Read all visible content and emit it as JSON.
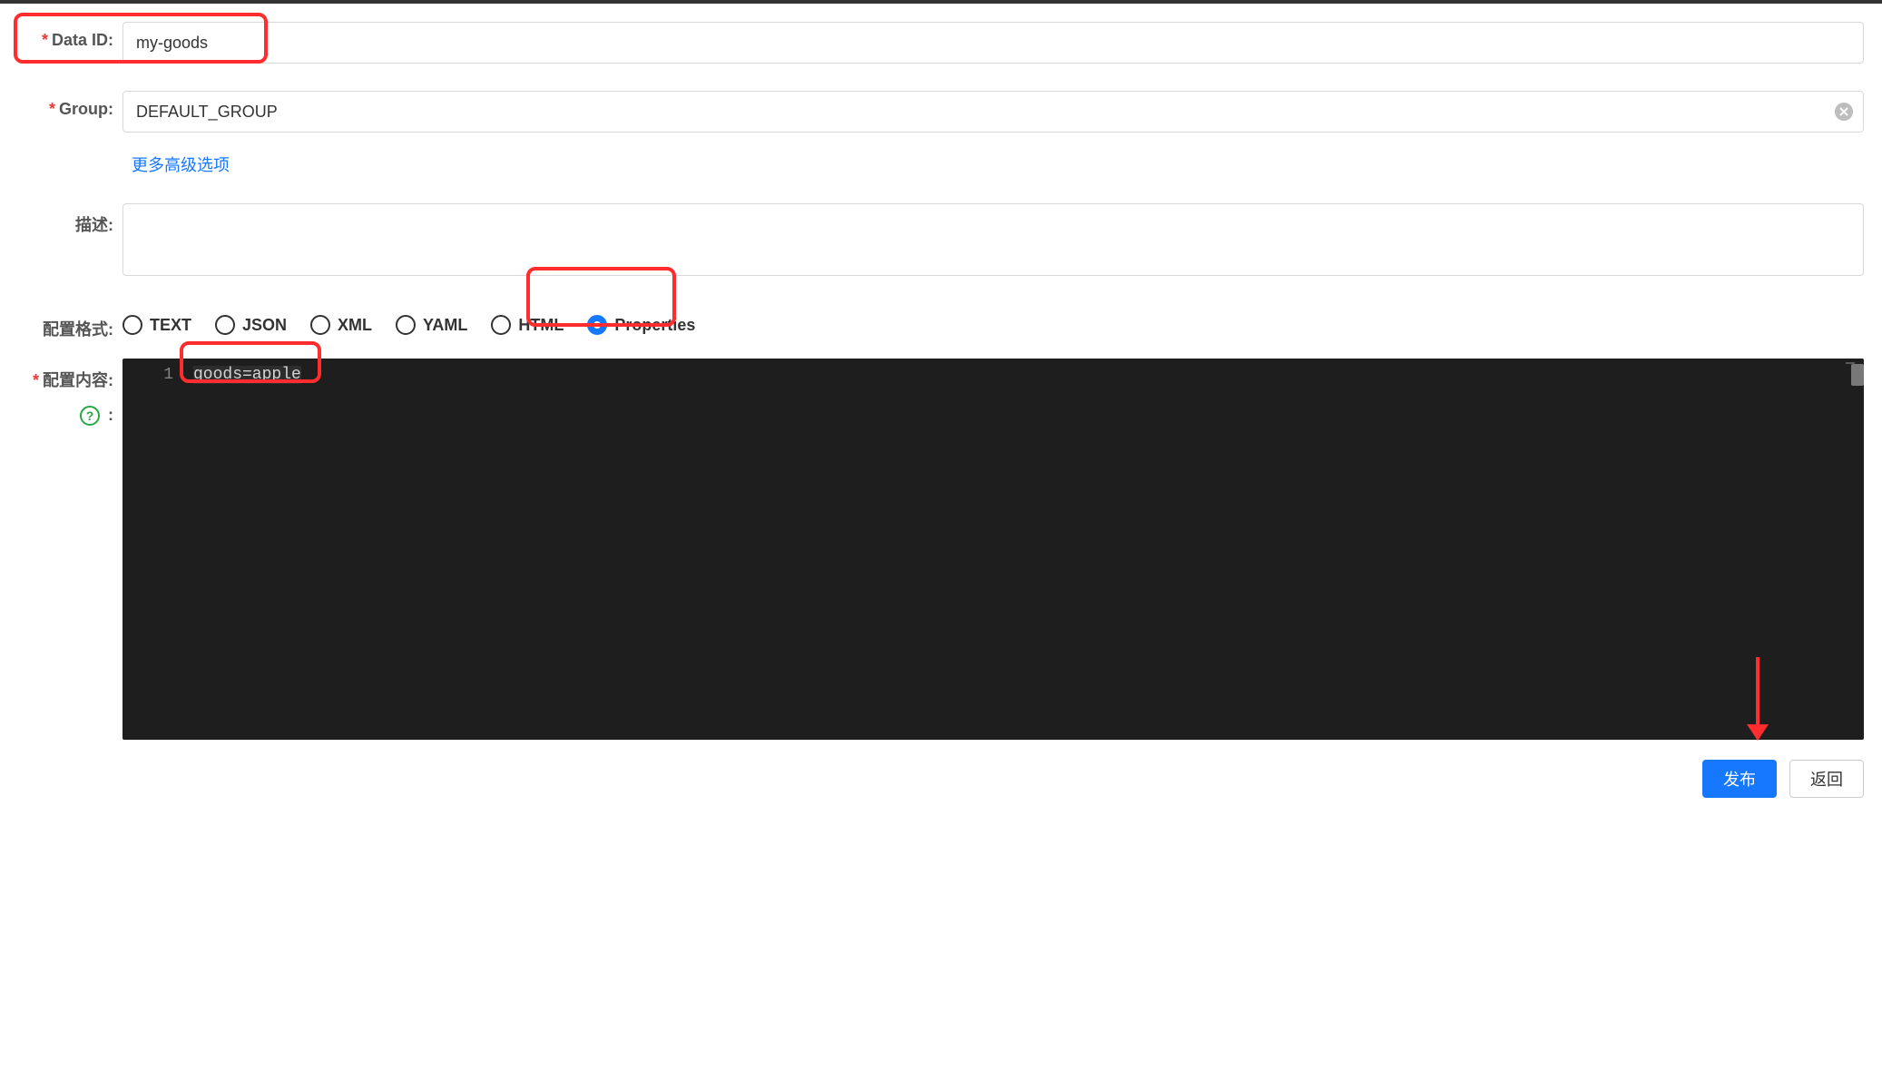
{
  "labels": {
    "data_id": "Data ID:",
    "group": "Group:",
    "advanced": "更多高级选项",
    "description": "描述:",
    "format": "配置格式:",
    "content": "配置内容:",
    "help_colon": ":"
  },
  "fields": {
    "data_id": "my-goods",
    "group": "DEFAULT_GROUP",
    "description": ""
  },
  "format_options": [
    {
      "value": "TEXT",
      "label": "TEXT",
      "checked": false
    },
    {
      "value": "JSON",
      "label": "JSON",
      "checked": false
    },
    {
      "value": "XML",
      "label": "XML",
      "checked": false
    },
    {
      "value": "YAML",
      "label": "YAML",
      "checked": false
    },
    {
      "value": "HTML",
      "label": "HTML",
      "checked": false
    },
    {
      "value": "Properties",
      "label": "Properties",
      "checked": true
    }
  ],
  "editor": {
    "line_number": "1",
    "content": "goods=apple"
  },
  "buttons": {
    "publish": "发布",
    "back": "返回"
  }
}
